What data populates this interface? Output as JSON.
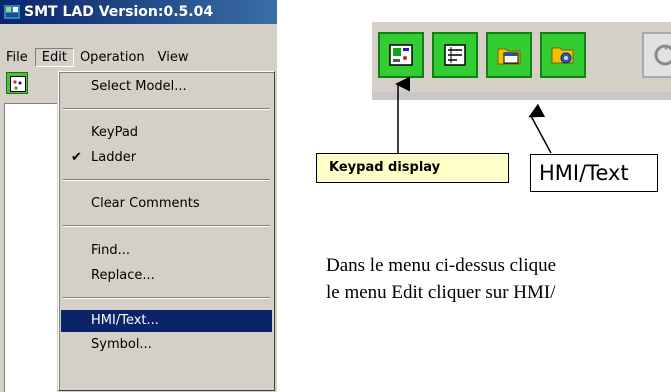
{
  "window": {
    "title": "SMT LAD Version:0.5.04"
  },
  "menubar": {
    "items": [
      {
        "label": "File"
      },
      {
        "label": "Edit"
      },
      {
        "label": "Operation"
      },
      {
        "label": "View"
      }
    ]
  },
  "edit_menu": {
    "items": [
      {
        "label": "Select Model..."
      },
      {
        "label": "KeyPad"
      },
      {
        "label": "Ladder",
        "checked": true
      },
      {
        "label": "Clear Comments"
      },
      {
        "label": "Find..."
      },
      {
        "label": "Replace..."
      },
      {
        "label": "HMI/Text...",
        "selected": true
      },
      {
        "label": "Symbol..."
      }
    ]
  },
  "toolbar": {
    "buttons": [
      {
        "icon": "keypad-display-icon"
      },
      {
        "icon": "ladder-program-icon"
      },
      {
        "icon": "hmi-text-icon"
      },
      {
        "icon": "folder-settings-icon"
      },
      {
        "icon": "refresh-icon"
      }
    ]
  },
  "callouts": {
    "keypad": "Keypad display",
    "hmi": "HMI/Text"
  },
  "instruction": {
    "line1": "Dans le menu ci-dessus clique",
    "line2": "le menu Edit cliquer sur HMI/"
  },
  "colors": {
    "titlebar": "#0a246a",
    "selection": "#0a246a",
    "toolbar_button": "#33cc33",
    "callout_fill": "#ffffc8"
  }
}
